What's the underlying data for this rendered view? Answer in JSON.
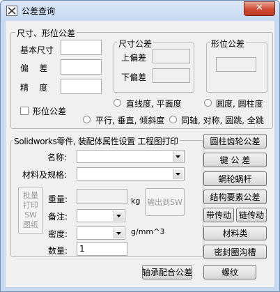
{
  "window": {
    "title": "公差查询",
    "close_label": "✕"
  },
  "tolerance": {
    "legend": "尺寸、形位公差",
    "basic_size_label": "基本尺寸",
    "deviation_label": "偏    差",
    "precision_label": "精    度",
    "size_tol": {
      "legend": "尺寸公差",
      "upper_label": "上偏差",
      "lower_label": "下偏差"
    },
    "form_tol": {
      "legend": "形位公差"
    },
    "form_tol_check_label": "形位公差",
    "radio_options": [
      "直线度, 平面度",
      "圆度, 圆柱度",
      "平行, 垂直, 倾斜度",
      "同轴, 对称, 圆跳, 全跳"
    ]
  },
  "props": {
    "legend": "Solidworks零件, 装配体属性设置 工程图打印",
    "name_label": "名称:",
    "material_label": "材料及规格:",
    "weight_label": "重量:",
    "weight_unit": "kg",
    "note_label": "备注:",
    "density_label": "密度:",
    "density_unit": "g/mm^3",
    "qty_label": "数量:",
    "qty_value": "1",
    "batch_print_label": "批量打印SW图纸",
    "output_sw_label": "输出到SW"
  },
  "side_buttons": [
    "圆柱齿轮公差",
    "键 公 差",
    "蜗轮蜗杆",
    "结构要素公差",
    "带传动",
    "链传动",
    "材料类",
    "密封圈沟槽"
  ],
  "bottom_buttons": {
    "shaft_hole": "轴承配合公差",
    "thread": "螺纹"
  }
}
